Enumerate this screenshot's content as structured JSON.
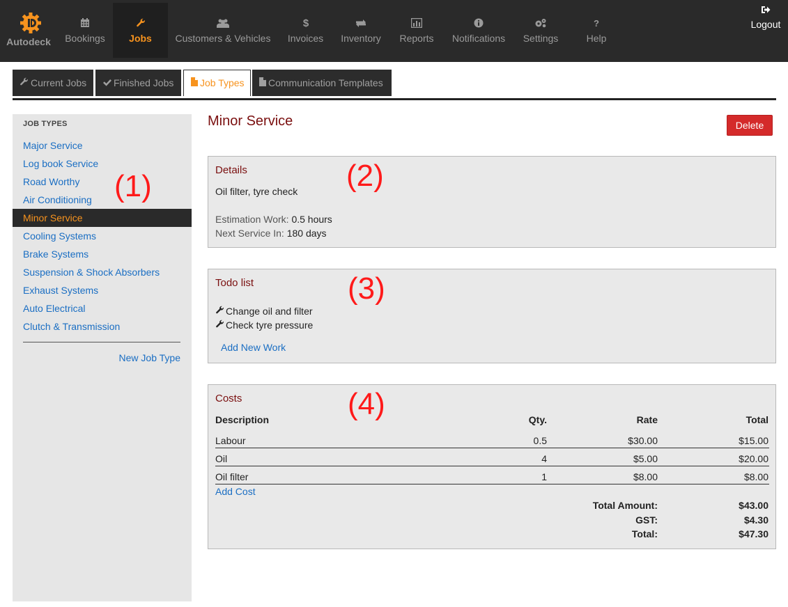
{
  "app": {
    "brand": "Autodeck",
    "logout_label": "Logout"
  },
  "nav": [
    {
      "label": "Bookings",
      "icon": "calendar-icon"
    },
    {
      "label": "Jobs",
      "icon": "wrench-icon",
      "active": true
    },
    {
      "label": "Customers & Vehicles",
      "icon": "users-icon"
    },
    {
      "label": "Invoices",
      "icon": "dollar-icon"
    },
    {
      "label": "Inventory",
      "icon": "exchange-icon"
    },
    {
      "label": "Reports",
      "icon": "bar-chart-icon"
    },
    {
      "label": "Notifications",
      "icon": "info-icon"
    },
    {
      "label": "Settings",
      "icon": "gears-icon"
    },
    {
      "label": "Help",
      "icon": "question-icon"
    }
  ],
  "subtabs": [
    {
      "label": "Current Jobs",
      "icon": "wrench-icon"
    },
    {
      "label": "Finished Jobs",
      "icon": "check-icon"
    },
    {
      "label": "Job Types",
      "icon": "file-icon",
      "active": true
    },
    {
      "label": "Communication Templates",
      "icon": "file-icon"
    }
  ],
  "sidebar": {
    "heading": "JOB TYPES",
    "items": [
      {
        "label": "Major Service"
      },
      {
        "label": "Log book Service"
      },
      {
        "label": "Road Worthy"
      },
      {
        "label": "Air Conditioning"
      },
      {
        "label": "Minor Service",
        "active": true
      },
      {
        "label": "Cooling Systems"
      },
      {
        "label": "Brake Systems"
      },
      {
        "label": "Suspension & Shock Absorbers"
      },
      {
        "label": "Exhaust Systems"
      },
      {
        "label": "Auto Electrical"
      },
      {
        "label": "Clutch & Transmission"
      }
    ],
    "new_link": "New Job Type"
  },
  "annotations": [
    "(1)",
    "(2)",
    "(3)",
    "(4)"
  ],
  "main": {
    "title": "Minor Service",
    "delete_label": "Delete",
    "details": {
      "title": "Details",
      "description": "Oil filter, tyre check",
      "estimation_label": "Estimation Work:",
      "estimation_value": "0.5 hours",
      "next_service_label": "Next Service In:",
      "next_service_value": "180 days"
    },
    "todo": {
      "title": "Todo list",
      "items": [
        "Change oil and filter",
        "Check tyre pressure"
      ],
      "add_link": "Add New Work"
    },
    "costs": {
      "title": "Costs",
      "headers": {
        "description": "Description",
        "qty": "Qty.",
        "rate": "Rate",
        "total": "Total"
      },
      "rows": [
        {
          "description": "Labour",
          "qty": "0.5",
          "rate": "$30.00",
          "total": "$15.00"
        },
        {
          "description": "Oil",
          "qty": "4",
          "rate": "$5.00",
          "total": "$20.00"
        },
        {
          "description": "Oil filter",
          "qty": "1",
          "rate": "$8.00",
          "total": "$8.00"
        }
      ],
      "add_link": "Add Cost",
      "summary": [
        {
          "label": "Total Amount:",
          "value": "$43.00"
        },
        {
          "label": "GST:",
          "value": "$4.30"
        },
        {
          "label": "Total:",
          "value": "$47.30"
        }
      ]
    }
  },
  "colors": {
    "accent": "#f7931e",
    "navbar": "#2a2a2a",
    "link": "#1a6ec3",
    "panel_title": "#7a0f0f",
    "danger": "#d42a2a",
    "annotation": "#ff1a1a"
  }
}
